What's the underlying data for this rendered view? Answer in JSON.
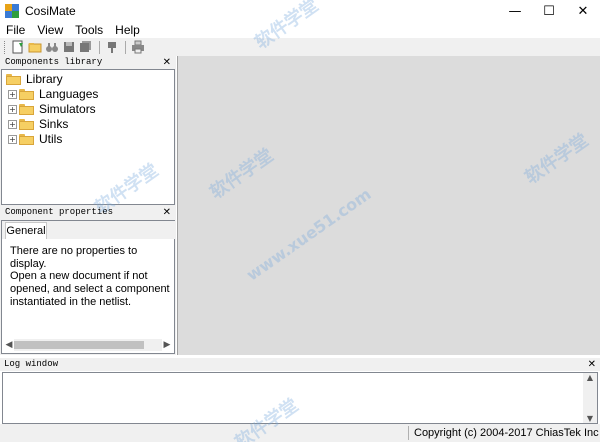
{
  "window": {
    "title": "CosiMate",
    "minimize_glyph": "—",
    "maximize_glyph": "☐",
    "close_glyph": "✕"
  },
  "menu": [
    "File",
    "View",
    "Tools",
    "Help"
  ],
  "toolbar": {
    "buttons": [
      "new-document-icon",
      "open-folder-icon",
      "binoculars-icon",
      "save-icon",
      "save-all-icon",
      "pin-icon",
      "print-icon"
    ]
  },
  "components_library": {
    "title": "Components library",
    "close_glyph": "✕",
    "root": "Library",
    "items": [
      {
        "label": "Languages",
        "expander": "+"
      },
      {
        "label": "Simulators",
        "expander": "+"
      },
      {
        "label": "Sinks",
        "expander": "+"
      },
      {
        "label": "Utils",
        "expander": "+"
      }
    ]
  },
  "component_properties": {
    "title": "Component properties",
    "close_glyph": "✕",
    "tab": "General",
    "line1": "There are no properties to display.",
    "line2": "Open a new document if not opened, and select a component instantiated in the netlist.",
    "scroll_left": "◀",
    "scroll_right": "▶"
  },
  "log_window": {
    "title": "Log window",
    "close_glyph": "✕",
    "scroll_up": "▲",
    "scroll_down": "▼"
  },
  "status": {
    "copyright": "Copyright (c) 2004-2017 ChiasTek Inc"
  },
  "watermark": {
    "text_cn": "软件学堂",
    "text_url": "www.xue51.com"
  },
  "colors": {
    "workspace_bg": "#dcdcdc",
    "panel_bg": "#f0f0f0",
    "folder": "#f6cf63"
  }
}
